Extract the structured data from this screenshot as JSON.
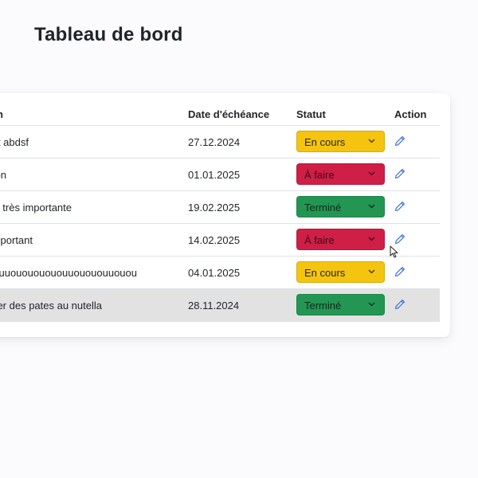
{
  "header": {
    "title": "Tableau de bord"
  },
  "table": {
    "columns": {
      "name": "n",
      "due_date": "Date d'échéance",
      "status": "Statut",
      "action": "Action"
    },
    "rows": [
      {
        "name": "Dev:Test abdsf",
        "due_date": "27.12.2024",
        "status": "En cours",
        "status_key": "inprogress"
      },
      {
        "name": "Tâche sans description",
        "due_date": "01.01.2025",
        "status": "À faire",
        "status_key": "todo"
      },
      {
        "name": "Une tâche très importante",
        "due_date": "19.02.2025",
        "status": "Terminé",
        "status_key": "done"
      },
      {
        "name": "Rien d'important",
        "due_date": "14.02.2025",
        "status": "À faire",
        "status_key": "todo"
      },
      {
        "name": "uouuouoouuouououououuouououuouou",
        "due_date": "04.01.2025",
        "status": "En cours",
        "status_key": "inprogress"
      },
      {
        "name": "Manger des pates au nutella",
        "due_date": "28.11.2024",
        "status": "Terminé",
        "status_key": "done"
      }
    ],
    "hovered_row": 6
  },
  "colors": {
    "in_progress": "#f5c40e",
    "todo": "#cf1f47",
    "done": "#239654",
    "edit_icon": "#3b6fd1",
    "row_hover": "#e2e2e2"
  },
  "icons": {
    "edit": "pencil-icon",
    "dropdown": "chevron-down-icon",
    "cursor": "mouse-pointer-icon"
  }
}
